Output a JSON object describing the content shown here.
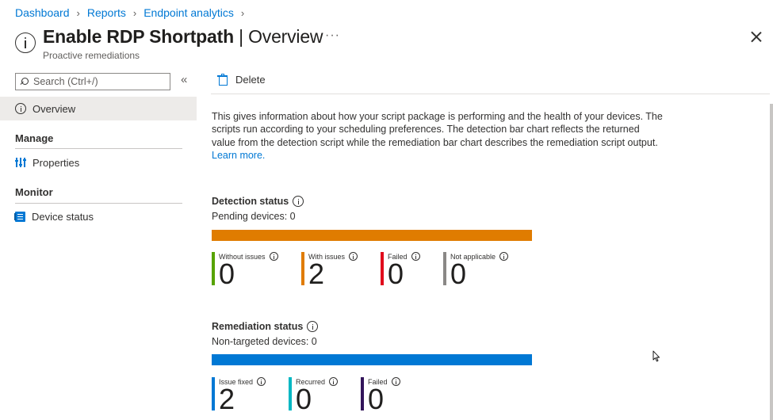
{
  "breadcrumb": [
    {
      "label": "Dashboard"
    },
    {
      "label": "Reports"
    },
    {
      "label": "Endpoint analytics"
    }
  ],
  "header": {
    "title_bold": "Enable RDP Shortpath",
    "title_suffix": " | Overview",
    "subtitle": "Proactive remediations",
    "more_label": "···"
  },
  "search": {
    "placeholder": "Search (Ctrl+/)"
  },
  "sidebar": {
    "collapse_label": "«",
    "overview_label": "Overview",
    "manage_header": "Manage",
    "properties_label": "Properties",
    "monitor_header": "Monitor",
    "device_status_label": "Device status"
  },
  "toolbar": {
    "delete_label": "Delete"
  },
  "description": {
    "text": "This gives information about how your script package is performing and the health of your devices. The scripts run according to your scheduling preferences. The detection bar chart reflects the returned value from the detection script while the remediation bar chart describes the remediation script output. ",
    "link": "Learn more."
  },
  "detection": {
    "title": "Detection status",
    "subtitle": "Pending devices: 0",
    "bar_color": "#e07c00",
    "metrics": [
      {
        "label": "Without issues",
        "value": "0",
        "color": "#57a300"
      },
      {
        "label": "With issues",
        "value": "2",
        "color": "#e07c00"
      },
      {
        "label": "Failed",
        "value": "0",
        "color": "#e00b1c"
      },
      {
        "label": "Not applicable",
        "value": "0",
        "color": "#8a8886"
      }
    ]
  },
  "remediation": {
    "title": "Remediation status",
    "subtitle": "Non-targeted devices: 0",
    "bar_color": "#0078d4",
    "metrics": [
      {
        "label": "Issue fixed",
        "value": "2",
        "color": "#0078d4"
      },
      {
        "label": "Recurred",
        "value": "0",
        "color": "#00b7c3"
      },
      {
        "label": "Failed",
        "value": "0",
        "color": "#32145a"
      }
    ]
  }
}
